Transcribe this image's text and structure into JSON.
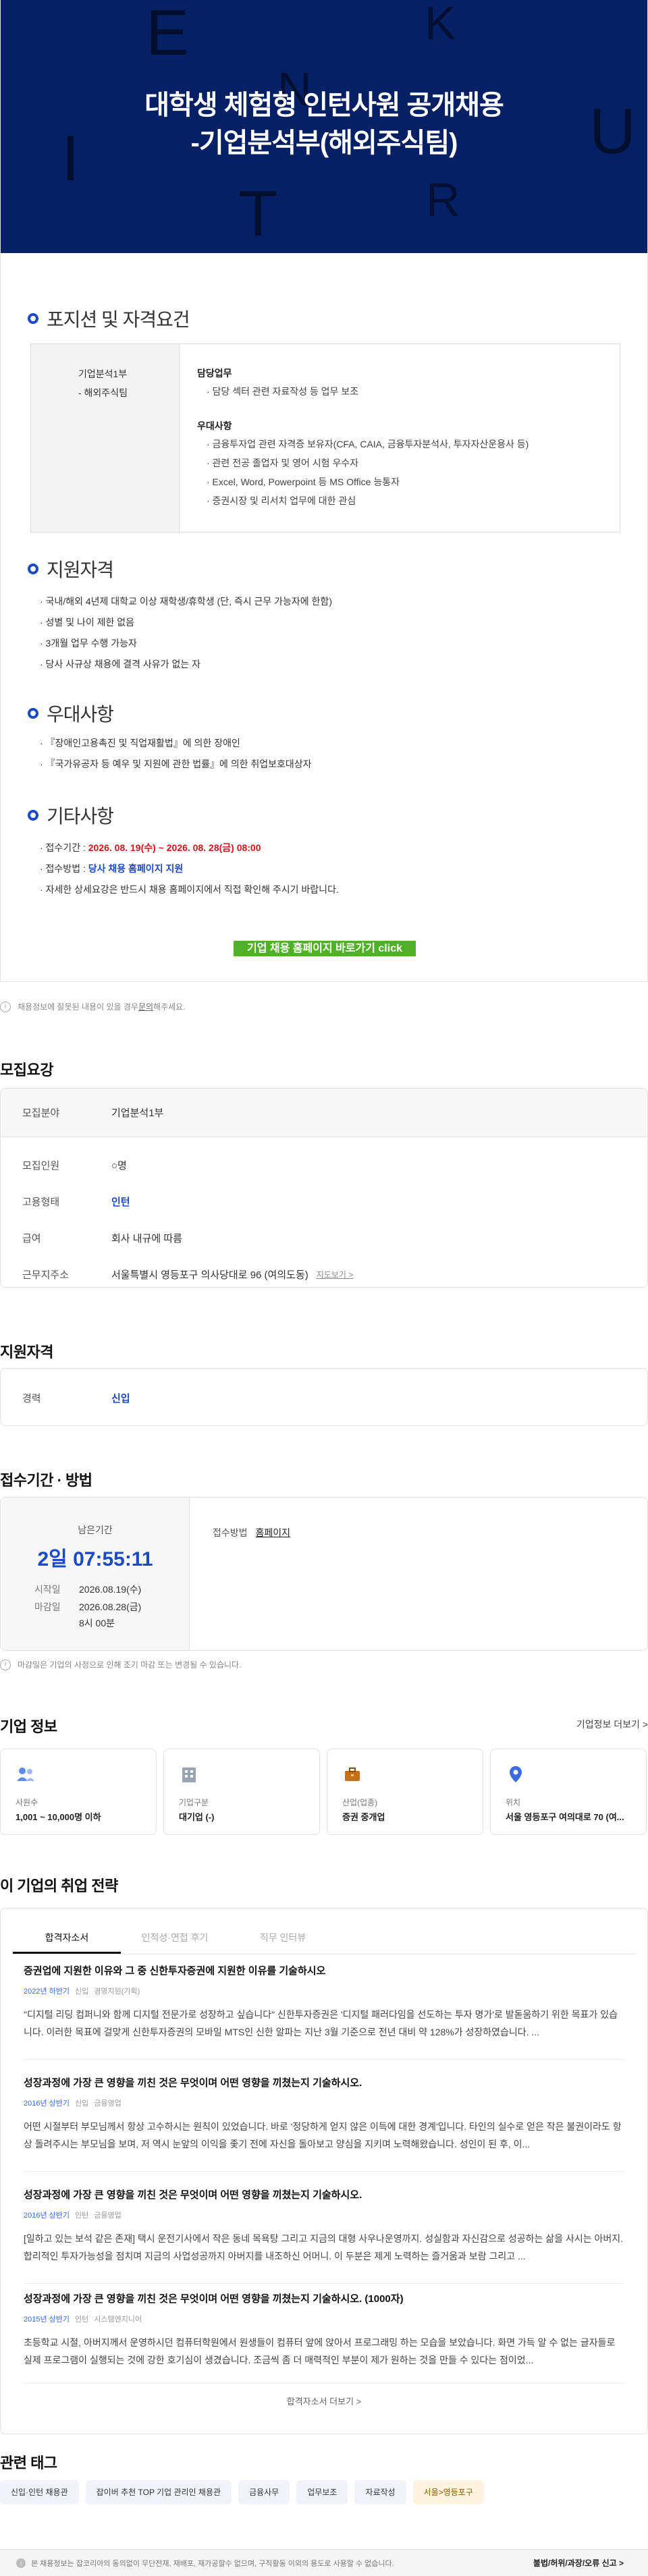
{
  "hero": {
    "title_line1": "대학생 체험형 인턴사원 공개채용",
    "title_line2": "-기업분석부(해외주식팀)",
    "bg_letters": [
      "E",
      "K",
      "N",
      "I",
      "T",
      "R",
      "U"
    ],
    "bg_color": "#062066"
  },
  "position": {
    "section_title": "포지션 및 자격요건",
    "dept_line1": "기업분석1부",
    "dept_line2": "- 해외주식팀",
    "duty_heading": "담당업무",
    "duties": [
      "· 담당 섹터 관련 자료작성 등 업무 보조"
    ],
    "pref_heading": "우대사항",
    "prefs": [
      "· 금융투자업 관련 자격증 보유자(CFA, CAIA, 금융투자분석사, 투자자산운용사 등)",
      "· 관련 전공 졸업자 및 영어 시험 우수자",
      "· Excel, Word, Powerpoint 등 MS Office 능통자",
      "· 증권시장 및 리서치 업무에 대한 관심"
    ]
  },
  "eligibility": {
    "section_title": "지원자격",
    "items": [
      "· 국내/해외 4년제 대학교 이상 재학생/휴학생 (단, 즉시 근무 가능자에 한함)",
      "· 성별 및 나이 제한 없음",
      "· 3개월 업무 수행 가능자",
      "· 당사 사규상 채용에 결격 사유가 없는 자"
    ]
  },
  "preference": {
    "section_title": "우대사항",
    "items": [
      "· 『장애인고용촉진 및 직업재활법』에 의한 장애인",
      "· 『국가유공자 등 예우 및 지원에 관한 법률』에 의한 취업보호대상자"
    ]
  },
  "other": {
    "section_title": "기타사항",
    "period_prefix": "· 접수기간 : ",
    "period_value": "2026. 08. 19(수) ~ 2026. 08. 28(금) 08:00",
    "method_prefix": "· 접수방법 : ",
    "method_value": "당사 채용 홈페이지 지원",
    "note": "· 자세한 상세요강은 반드시 채용 홈페이지에서 직접 확인해 주시기 바랍니다."
  },
  "cta_label": "기업 채용 홈페이지 바로가기 click",
  "posting_notice_pre": "채용정보에 잘못된 내용이 있을 경우 ",
  "posting_notice_link": "문의",
  "posting_notice_post": "해주세요.",
  "recruit": {
    "title": "모집요강",
    "rows": [
      {
        "k": "모집분야",
        "v": "기업분석1부"
      },
      {
        "k": "모집인원",
        "v": "○명"
      },
      {
        "k": "고용형태",
        "v": "인턴"
      },
      {
        "k": "급여",
        "v": "회사 내규에 따름"
      },
      {
        "k": "근무지주소",
        "v": "서울특별시 영등포구 의사당대로 96 (여의도동)"
      }
    ],
    "map_link": "지도보기 >"
  },
  "qualification": {
    "title": "지원자격",
    "k": "경력",
    "v": "신입"
  },
  "period": {
    "title": "접수기간 · 방법",
    "remaining_label": "남은기간",
    "remaining_value": "2일 07:55:11",
    "start_label": "시작일",
    "start_value": "2026.08.19(수)",
    "end_label": "마감일",
    "end_value": "2026.08.28(금)",
    "end_time": "8시 00분",
    "method_label": "접수방법",
    "method_value": "홈페이지",
    "notice": "마감일은 기업의 사정으로 인해 조기 마감 또는 변경될 수 있습니다."
  },
  "company": {
    "title": "기업 정보",
    "more": "기업정보 더보기 >",
    "cards": [
      {
        "label": "사원수",
        "value": "1,001 ~ 10,000명 이하",
        "icon": "people-icon"
      },
      {
        "label": "기업구분",
        "value": "대기업 (-)",
        "icon": "building-icon"
      },
      {
        "label": "산업(업종)",
        "value": "증권 중개업",
        "icon": "briefcase-icon"
      },
      {
        "label": "위치",
        "value": "서울 영등포구 여의대로 70 (여...",
        "icon": "location-pin-icon"
      }
    ]
  },
  "strategy": {
    "title": "이 기업의 취업 전략",
    "tabs": [
      "합격자소서",
      "인적성·면접 후기",
      "직무 인터뷰"
    ],
    "items": [
      {
        "q": "증권업에 지원한 이유와 그 중 신한투자증권에 지원한 이유를 기술하시오",
        "year": "2022년 하반기",
        "type": "신입",
        "field": "경영지원(기획)",
        "body": "\"디지털 리딩 컴퍼니와 함께 디지털 전문가로 성장하고 싶습니다\" 신한투자증권은 '디지털 패러다임을 선도하는 투자 명가'로 발돋움하기 위한 목표가 있습니다. 이러한 목표에 걸맞게 신한투자증권의 모바일 MTS인 신한 알파는 지난 3월 기준으로 전년 대비 약 128%가 성장하였습니다. ..."
      },
      {
        "q": "성장과정에 가장 큰 영향을 끼친 것은 무엇이며 어떤 영향을 끼쳤는지 기술하시오.",
        "year": "2016년 상반기",
        "type": "신입",
        "field": "금융영업",
        "body": "어떤 시절부터 부모님께서 항상 고수하시는 원칙이 있었습니다. 바로 '정당하게 얻지 않은 이득에 대한 경계'입니다. 타인의 실수로 얻은 작은 불권이라도 항상 돌려주시는 부모님을 보며, 저 역시 눈앞의 이익을 좇기 전에 자신을 돌아보고 양심을 지키며 노력해왔습니다. 성인이 된 후, 이..."
      },
      {
        "q": "성장과정에 가장 큰 영향을 끼친 것은 무엇이며 어떤 영향을 끼쳤는지 기술하시오.",
        "year": "2016년 상반기",
        "type": "인턴",
        "field": "금융영업",
        "body": "[일하고 있는 보석 같은 존재] 택시 운전기사에서 작은 동네 목욕탕 그리고 지금의 대형 사우나운영까지. 성실함과 자신감으로 성공하는 삶을 사시는 아버지. 합리적인 투자가능성을 점치며 지금의 사업성공까지 아버지를 내조하신 어머니. 이 두분은 제게 노력하는 즐거움과 보람 그리고 ..."
      },
      {
        "q": "성장과정에 가장 큰 영향을 끼친 것은 무엇이며 어떤 영향을 끼쳤는지 기술하시오. (1000자)",
        "year": "2015년 상반기",
        "type": "인턴",
        "field": "시스템엔지니어",
        "body": "초등학교 시절, 아버지께서 운영하시던 컴퓨터학원에서 원생들이 컴퓨터 앞에 앉아서 프로그래밍 하는 모습을 보았습니다. 화면 가득 알 수 없는 글자들로 실제 프로그램이 실행되는 것에 강한 호기심이 생겼습니다. 조금씩 좀 더 매력적인 부분이 제가 원하는 것을 만들 수 있다는 점이었..."
      }
    ],
    "more": "합격자소서 더보기 >"
  },
  "tags": {
    "title": "관련 태그",
    "items": [
      "신입·인턴 채용관",
      "잡이버 추천 TOP 기업 관리인 채용관",
      "금융사무",
      "업무보조",
      "자료작성",
      "서울>영등포구"
    ]
  },
  "footer": {
    "notice": "본 채용정보는 잡코리아의 동의없이 무단전재, 재배포, 재가공할수 없으며, 구직활동 이외의 용도로 사용할 수 없습니다.",
    "report": "불법/허위/과장/오류 신고 >"
  },
  "colors": {
    "accent_blue": "#1a49c9",
    "deadline_red": "#d7141a",
    "cta_green": "#4fb226"
  }
}
